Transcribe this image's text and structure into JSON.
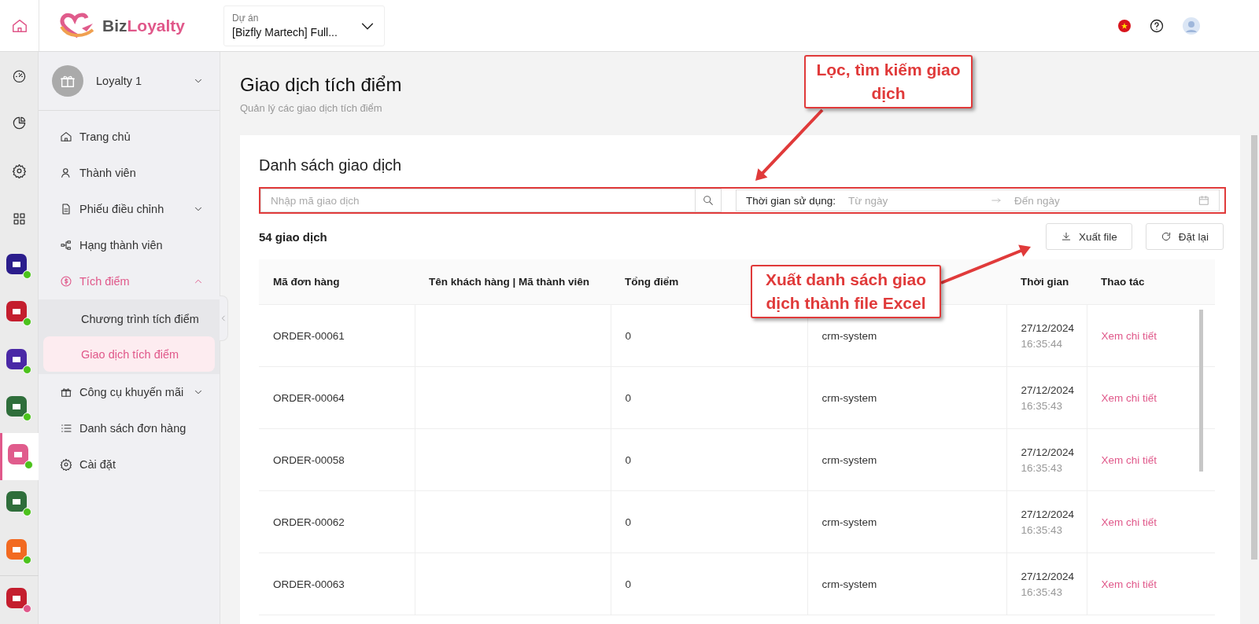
{
  "topbar": {
    "logo": {
      "part_1": "Biz",
      "part_2": "Loyalty"
    },
    "project": {
      "label": "Dự án",
      "value": "[Bizfly Martech] Full..."
    }
  },
  "rail": {
    "tools": [
      {
        "kind": "gauge"
      },
      {
        "kind": "pie"
      },
      {
        "kind": "gear"
      },
      {
        "kind": "grid"
      }
    ],
    "apps": [
      {
        "color": "#2b1d8c",
        "selected": false
      },
      {
        "color": "#c41e2e",
        "selected": false
      },
      {
        "color": "#4a28a6",
        "selected": false
      },
      {
        "color": "#2f6e3b",
        "selected": false
      },
      {
        "color": "#e05c8c",
        "selected": true
      },
      {
        "color": "#2f6e3b",
        "selected": false
      },
      {
        "color": "#f26a21",
        "selected": false
      }
    ]
  },
  "sidebar": {
    "workspace": "Loyalty 1",
    "items": [
      {
        "kind": "home",
        "label": "Trang chủ",
        "active": false
      },
      {
        "kind": "users",
        "label": "Thành viên",
        "active": false
      },
      {
        "kind": "doc",
        "label": "Phiếu điều chỉnh",
        "active": false,
        "expanded": false
      },
      {
        "kind": "tiers",
        "label": "Hạng thành viên",
        "active": false
      },
      {
        "kind": "coin",
        "label": "Tích điểm",
        "active": true,
        "expanded": true,
        "children": [
          {
            "label": "Chương trình tích điểm",
            "selected": false
          },
          {
            "label": "Giao dịch tích điểm",
            "selected": true
          }
        ]
      },
      {
        "kind": "gift",
        "label": "Công cụ khuyến mãi",
        "active": false,
        "expanded": false
      },
      {
        "kind": "list",
        "label": "Danh sách đơn hàng",
        "active": false
      },
      {
        "kind": "gear",
        "label": "Cài đặt",
        "active": false
      }
    ]
  },
  "page": {
    "title": "Giao dịch tích điểm",
    "subtitle": "Quản lý các giao dịch tích điểm"
  },
  "card": {
    "title": "Danh sách giao dịch",
    "search": {
      "placeholder": "Nhập mã giao dịch"
    },
    "date_filter": {
      "label": "Thời gian sử dụng:",
      "from_placeholder": "Từ ngày",
      "to_placeholder": "Đến ngày"
    },
    "count": "54 giao dịch",
    "buttons": [
      {
        "kind": "download",
        "label": "Xuất file"
      },
      {
        "kind": "reset",
        "label": "Đặt lại"
      }
    ],
    "table": {
      "columns": [
        "Mã đơn hàng",
        "Tên khách hàng | Mã thành viên",
        "Tổng điểm",
        null,
        "Thời gian",
        "Thao tác"
      ],
      "rows": [
        {
          "order": "ORDER-00061",
          "points": "0",
          "column_4": "crm-system",
          "date": "27/12/2024",
          "time": "16:35:44",
          "action": "Xem chi tiết"
        },
        {
          "order": "ORDER-00064",
          "points": "0",
          "column_4": "crm-system",
          "date": "27/12/2024",
          "time": "16:35:43",
          "action": "Xem chi tiết"
        },
        {
          "order": "ORDER-00058",
          "points": "0",
          "column_4": "crm-system",
          "date": "27/12/2024",
          "time": "16:35:43",
          "action": "Xem chi tiết"
        },
        {
          "order": "ORDER-00062",
          "points": "0",
          "column_4": "crm-system",
          "date": "27/12/2024",
          "time": "16:35:43",
          "action": "Xem chi tiết"
        },
        {
          "order": "ORDER-00063",
          "points": "0",
          "column_4": "crm-system",
          "date": "27/12/2024",
          "time": "16:35:43",
          "action": "Xem chi tiết"
        }
      ]
    }
  },
  "annotations": [
    {
      "text": "Lọc, tìm kiếm giao dịch"
    },
    {
      "text": "Xuất danh sách giao dịch thành file Excel"
    }
  ]
}
